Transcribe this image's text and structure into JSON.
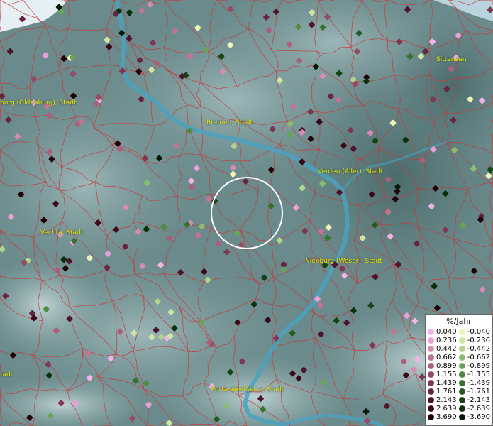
{
  "map": {
    "places": [
      {
        "id": "oldenburg",
        "label": "burg (Oldenburg), Stadt"
      },
      {
        "id": "bremen",
        "label": "Bremen, Stadt"
      },
      {
        "id": "sittensen",
        "label": "Sittensen"
      },
      {
        "id": "verden",
        "label": "Verden (Aller), Stadt"
      },
      {
        "id": "vechta",
        "label": "Vechta, Stadt"
      },
      {
        "id": "nienburg",
        "label": "Nienburg (Weser), Stadt"
      },
      {
        "id": "porta",
        "label": "Porta Westfalica, Stadt"
      },
      {
        "id": "stadt-left",
        "label": "tadt"
      }
    ]
  },
  "legend": {
    "title": "%/Jahr",
    "positive": [
      {
        "value": "0.040",
        "color": "#f0b4e6"
      },
      {
        "value": "0.236",
        "color": "#e9a0d6"
      },
      {
        "value": "0.442",
        "color": "#d68ab4"
      },
      {
        "value": "0.662",
        "color": "#c27496"
      },
      {
        "value": "0.899",
        "color": "#ac5f7c"
      },
      {
        "value": "1.155",
        "color": "#964a66"
      },
      {
        "value": "1.439",
        "color": "#7e3652"
      },
      {
        "value": "1.761",
        "color": "#66243e"
      },
      {
        "value": "2.143",
        "color": "#4e142c"
      },
      {
        "value": "2.639",
        "color": "#38081a"
      },
      {
        "value": "3.690",
        "color": "#220008"
      }
    ],
    "negative": [
      {
        "value": "-0.040",
        "color": "#eef5b8"
      },
      {
        "value": "-0.236",
        "color": "#cfe6a4"
      },
      {
        "value": "-0.442",
        "color": "#b0d48c"
      },
      {
        "value": "-0.662",
        "color": "#8cbc70"
      },
      {
        "value": "-0.899",
        "color": "#6aa456"
      },
      {
        "value": "-1.155",
        "color": "#4e8c40"
      },
      {
        "value": "-1.439",
        "color": "#36742e"
      },
      {
        "value": "-1.761",
        "color": "#225c20"
      },
      {
        "value": "-2.143",
        "color": "#144614"
      },
      {
        "value": "-2.639",
        "color": "#0a300a"
      },
      {
        "value": "-3.690",
        "color": "#021a04"
      }
    ]
  }
}
